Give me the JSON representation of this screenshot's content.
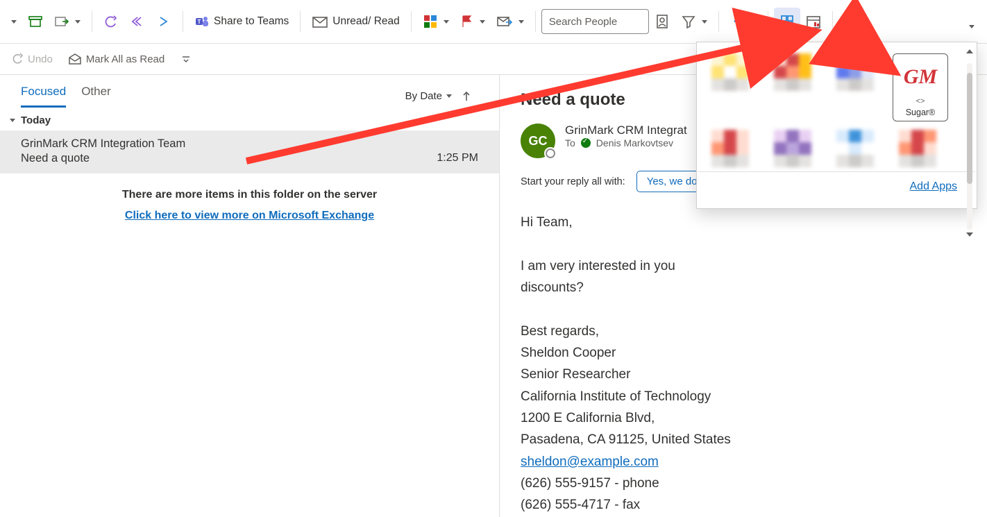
{
  "ribbon": {
    "share_teams": "Share to Teams",
    "unread_read": "Unread/ Read",
    "search_placeholder": "Search People"
  },
  "subbar": {
    "undo": "Undo",
    "mark_all": "Mark All as Read"
  },
  "list": {
    "tab_focused": "Focused",
    "tab_other": "Other",
    "sort": "By Date",
    "group_today": "Today",
    "message": {
      "from": "GrinMark CRM Integration Team",
      "subject": "Need a quote",
      "time": "1:25 PM"
    },
    "more_line1": "There are more items in this folder on the server",
    "more_line2": "Click here to view more on Microsoft Exchange"
  },
  "reading": {
    "subject": "Need a quote",
    "avatar_initials": "GC",
    "from": "GrinMark CRM Integrat",
    "to_label": "To",
    "to_name": "Denis Markovtsev",
    "reply_label": "Start your reply all with:",
    "suggestion": "Yes, we do.",
    "greeting": "Hi Team,",
    "para1_a": "I am very interested in you",
    "para1_b": "discounts?",
    "closing": "Best regards,",
    "sig_name": "Sheldon Cooper",
    "sig_title": "Senior Researcher",
    "sig_org": "California Institute of Technology",
    "sig_addr1": "1200 E California Blvd,",
    "sig_addr2": "Pasadena, CA 91125, United States",
    "sig_email": "sheldon@example.com",
    "sig_phone": "(626) 555-9157 - phone",
    "sig_fax": "(626) 555-4717 - fax"
  },
  "popover": {
    "app_name": "GM",
    "app_sub": "<>",
    "app_label": "Sugar®",
    "add_apps": "Add Apps"
  }
}
